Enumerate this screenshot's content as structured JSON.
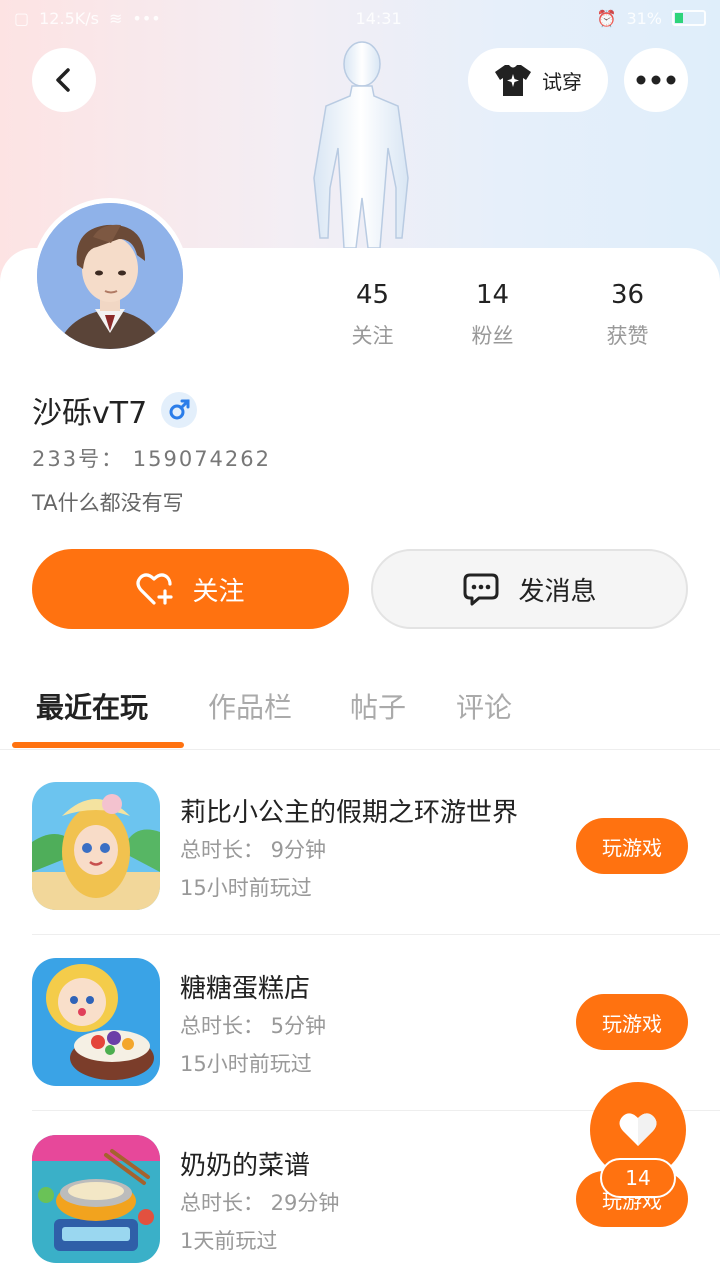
{
  "status_bar": {
    "left": "12.5K/s",
    "time": "14:31",
    "battery": "31%"
  },
  "header": {
    "tryon_label": "试穿"
  },
  "profile": {
    "following_count": "45",
    "following_label": "关注",
    "fans_count": "14",
    "fans_label": "粉丝",
    "likes_count": "36",
    "likes_label": "获赞",
    "name": "沙砾vT7",
    "gender": "male",
    "uid": "233号： 159074262",
    "bio": "TA什么都没有写"
  },
  "actions": {
    "follow_label": "关注",
    "message_label": "发消息"
  },
  "tabs": [
    {
      "label": "最近在玩",
      "active": true
    },
    {
      "label": "作品栏",
      "active": false
    },
    {
      "label": "帖子",
      "active": false
    },
    {
      "label": "评论",
      "active": false
    }
  ],
  "games": [
    {
      "title": "莉比小公主的假期之环游世界",
      "duration": "总时长： 9分钟",
      "last_played": "15小时前玩过",
      "play_label": "玩游戏"
    },
    {
      "title": "糖糖蛋糕店",
      "duration": "总时长： 5分钟",
      "last_played": "15小时前玩过",
      "play_label": "玩游戏"
    },
    {
      "title": "奶奶的菜谱",
      "duration": "总时长： 29分钟",
      "last_played": "1天前玩过",
      "play_label": "玩游戏"
    }
  ],
  "fab": {
    "count": "14"
  },
  "colors": {
    "accent": "#ff7210",
    "muted_text": "#999999"
  }
}
